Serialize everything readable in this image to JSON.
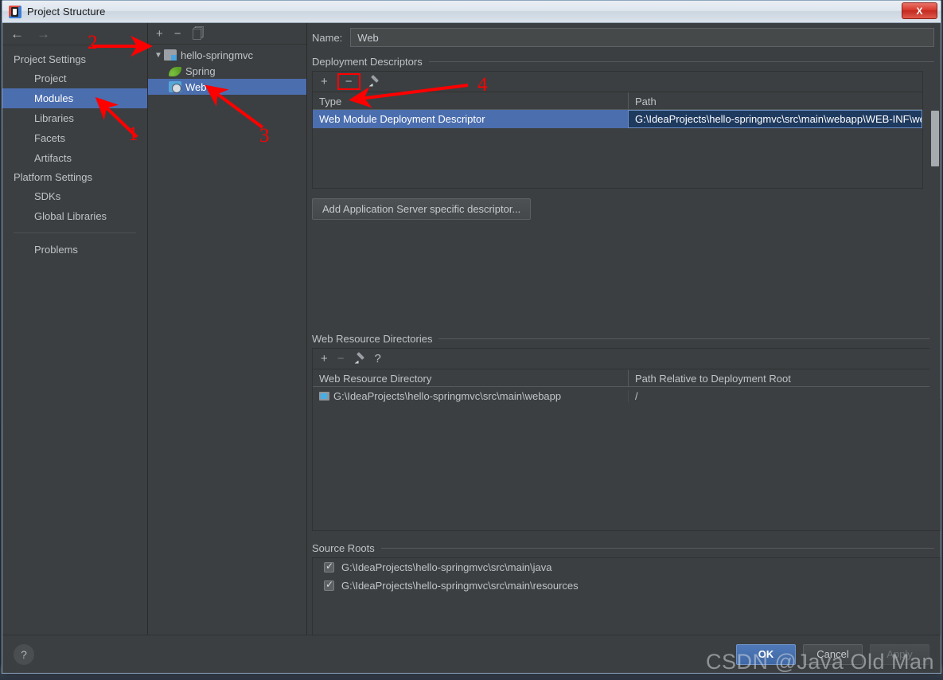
{
  "window": {
    "title": "Project Structure",
    "icon": "intellij-idea-icon",
    "close_label": "X"
  },
  "sidebar": {
    "back_icon": "arrow-left-icon",
    "forward_icon": "arrow-right-icon",
    "groups": [
      {
        "label": "Project Settings",
        "items": [
          {
            "label": "Project",
            "selected": false
          },
          {
            "label": "Modules",
            "selected": true
          },
          {
            "label": "Libraries",
            "selected": false
          },
          {
            "label": "Facets",
            "selected": false
          },
          {
            "label": "Artifacts",
            "selected": false
          }
        ]
      },
      {
        "label": "Platform Settings",
        "items": [
          {
            "label": "SDKs",
            "selected": false
          },
          {
            "label": "Global Libraries",
            "selected": false
          }
        ]
      }
    ],
    "extra": {
      "label": "Problems"
    }
  },
  "tree_panel": {
    "toolbar": {
      "add": "+",
      "remove": "−",
      "copy_icon": "copy-icon"
    },
    "nodes": [
      {
        "label": "hello-springmvc",
        "icon": "module-folder-icon",
        "expanded": true,
        "level": 0,
        "selected": false
      },
      {
        "label": "Spring",
        "icon": "spring-leaf-icon",
        "level": 1,
        "selected": false
      },
      {
        "label": "Web",
        "icon": "web-facet-icon",
        "level": 1,
        "selected": true
      }
    ]
  },
  "content": {
    "name_label": "Name:",
    "name_value": "Web",
    "deployment": {
      "title": "Deployment Descriptors",
      "toolbar": {
        "add": "+",
        "remove": "−",
        "edit_icon": "pencil-icon"
      },
      "columns": [
        "Type",
        "Path"
      ],
      "rows": [
        {
          "type": "Web Module Deployment Descriptor",
          "path": "G:\\IdeaProjects\\hello-springmvc\\src\\main\\webapp\\WEB-INF\\web.x",
          "selected": true
        }
      ],
      "add_server_descriptor_button": "Add Application Server specific descriptor..."
    },
    "web_resources": {
      "title": "Web Resource Directories",
      "toolbar": {
        "add": "+",
        "remove": "−",
        "edit_icon": "pencil-icon",
        "help": "?"
      },
      "columns": [
        "Web Resource Directory",
        "Path Relative to Deployment Root"
      ],
      "rows": [
        {
          "dir": "G:\\IdeaProjects\\hello-springmvc\\src\\main\\webapp",
          "relative": "/"
        }
      ]
    },
    "source_roots": {
      "title": "Source Roots",
      "items": [
        {
          "path": "G:\\IdeaProjects\\hello-springmvc\\src\\main\\java",
          "checked": true
        },
        {
          "path": "G:\\IdeaProjects\\hello-springmvc\\src\\main\\resources",
          "checked": true
        }
      ]
    }
  },
  "footer": {
    "help": "?",
    "ok": "OK",
    "cancel": "Cancel",
    "apply": "Apply"
  },
  "annotations": [
    {
      "number": "1",
      "target": "sidebar-item-modules"
    },
    {
      "number": "2",
      "target": "module-tree-panel"
    },
    {
      "number": "3",
      "target": "tree-node-web"
    },
    {
      "number": "4",
      "target": "deployment-remove-button"
    }
  ],
  "watermark": "CSDN @Java Old Man",
  "colors": {
    "selection_blue": "#4b6eaf",
    "annotation_red": "#ff0000",
    "panel_bg": "#3c3f41",
    "primary_button": "#3f68a6"
  }
}
